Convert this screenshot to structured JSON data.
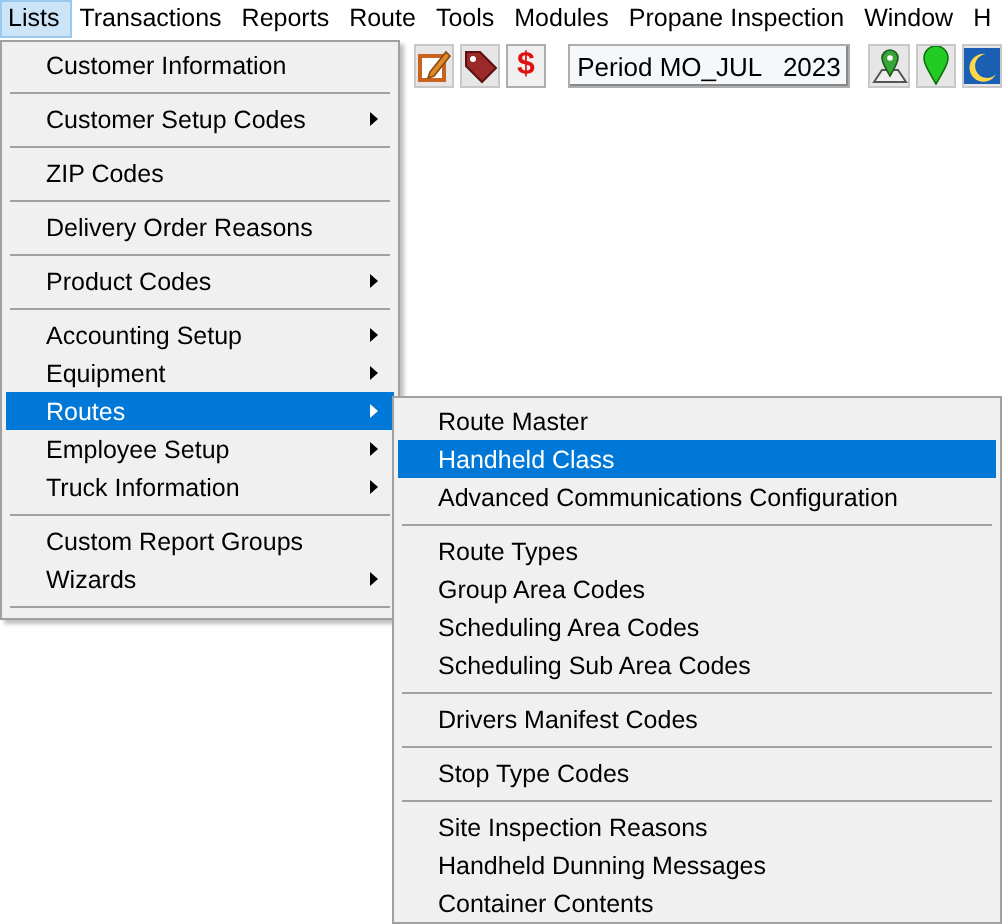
{
  "menubar": [
    {
      "label": "Lists",
      "selected": true
    },
    {
      "label": "Transactions",
      "selected": false
    },
    {
      "label": "Reports",
      "selected": false
    },
    {
      "label": "Route",
      "selected": false
    },
    {
      "label": "Tools",
      "selected": false
    },
    {
      "label": "Modules",
      "selected": false
    },
    {
      "label": "Propane Inspection",
      "selected": false
    },
    {
      "label": "Window",
      "selected": false
    },
    {
      "label": "H",
      "selected": false
    }
  ],
  "toolbar": {
    "dollar_button": "$",
    "period": "Period MO_JUL   2023"
  },
  "lists_menu": [
    {
      "kind": "item",
      "label": "Customer Information",
      "submenu": false,
      "selected": false
    },
    {
      "kind": "separator"
    },
    {
      "kind": "item",
      "label": "Customer Setup Codes",
      "submenu": true,
      "selected": false
    },
    {
      "kind": "separator"
    },
    {
      "kind": "item",
      "label": "ZIP Codes",
      "submenu": false,
      "selected": false
    },
    {
      "kind": "separator"
    },
    {
      "kind": "item",
      "label": "Delivery Order Reasons",
      "submenu": false,
      "selected": false
    },
    {
      "kind": "separator"
    },
    {
      "kind": "item",
      "label": "Product Codes",
      "submenu": true,
      "selected": false
    },
    {
      "kind": "separator"
    },
    {
      "kind": "item",
      "label": "Accounting Setup",
      "submenu": true,
      "selected": false
    },
    {
      "kind": "item",
      "label": "Equipment",
      "submenu": true,
      "selected": false
    },
    {
      "kind": "item",
      "label": "Routes",
      "submenu": true,
      "selected": true
    },
    {
      "kind": "item",
      "label": "Employee Setup",
      "submenu": true,
      "selected": false
    },
    {
      "kind": "item",
      "label": "Truck Information",
      "submenu": true,
      "selected": false
    },
    {
      "kind": "separator"
    },
    {
      "kind": "item",
      "label": "Custom Report Groups",
      "submenu": false,
      "selected": false
    },
    {
      "kind": "item",
      "label": "Wizards",
      "submenu": true,
      "selected": false
    },
    {
      "kind": "separator"
    }
  ],
  "routes_submenu": [
    {
      "kind": "item",
      "label": "Route Master",
      "selected": false
    },
    {
      "kind": "item",
      "label": "Handheld Class",
      "selected": true
    },
    {
      "kind": "item",
      "label": "Advanced Communications Configuration",
      "selected": false
    },
    {
      "kind": "separator"
    },
    {
      "kind": "item",
      "label": "Route Types",
      "selected": false
    },
    {
      "kind": "item",
      "label": "Group  Area Codes",
      "selected": false
    },
    {
      "kind": "item",
      "label": "Scheduling Area Codes",
      "selected": false
    },
    {
      "kind": "item",
      "label": "Scheduling Sub Area Codes",
      "selected": false
    },
    {
      "kind": "separator"
    },
    {
      "kind": "item",
      "label": "Drivers Manifest Codes",
      "selected": false
    },
    {
      "kind": "separator"
    },
    {
      "kind": "item",
      "label": "Stop Type Codes",
      "selected": false
    },
    {
      "kind": "separator"
    },
    {
      "kind": "item",
      "label": "Site Inspection Reasons",
      "selected": false
    },
    {
      "kind": "item",
      "label": "Handheld Dunning Messages",
      "selected": false
    },
    {
      "kind": "item",
      "label": "Container Contents",
      "selected": false
    }
  ]
}
